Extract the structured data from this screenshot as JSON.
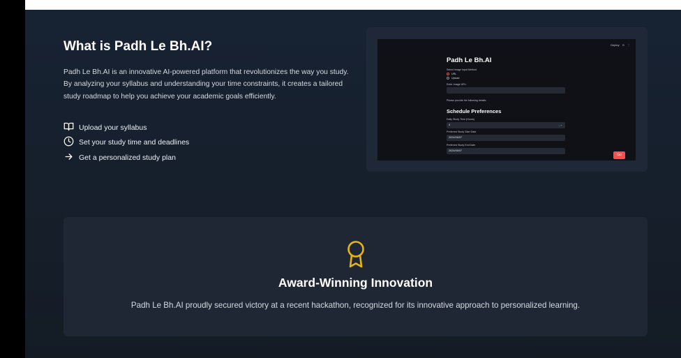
{
  "about": {
    "title": "What is Padh Le Bh.AI?",
    "description": "Padh Le Bh.AI is an innovative AI-powered platform that revolutionizes the way you study. By analyzing your syllabus and understanding your time constraints, it creates a tailored study roadmap to help you achieve your academic goals efficiently.",
    "features": [
      {
        "icon": "book-open-icon",
        "label": "Upload your syllabus"
      },
      {
        "icon": "clock-icon",
        "label": "Set your study time and deadlines"
      },
      {
        "icon": "arrow-right-icon",
        "label": "Get a personalized study plan"
      }
    ]
  },
  "preview": {
    "topbar": [
      "Deploy",
      "⊙",
      "⋮"
    ],
    "title": "Padh Le Bh.AI",
    "input_method_label": "Select Image Input Method",
    "radio_options": [
      {
        "label": "URL",
        "selected": true
      },
      {
        "label": "Upload",
        "selected": false
      }
    ],
    "url_label": "Enter Image URL:",
    "details_prompt": "Please provide the following details:",
    "schedule_heading": "Schedule Preferences",
    "daily_time_label": "Daily Study Time (Hours)",
    "daily_time_value": "4",
    "start_date_label": "Preferred Study Start Date",
    "start_date_value": "2024/06/07",
    "end_date_label": "Preferred Study End Date",
    "end_date_value": "2024/06/07",
    "button_label": "Go"
  },
  "award": {
    "icon": "award-icon",
    "title": "Award-Winning Innovation",
    "description": "Padh Le Bh.AI proudly secured victory at a recent hackathon, recognized for its innovative approach to personalized learning."
  },
  "colors": {
    "background": "#161f2b",
    "card": "#1e2733",
    "accent_gold": "#e5b611",
    "streamlit_red": "#ff4b4b"
  }
}
